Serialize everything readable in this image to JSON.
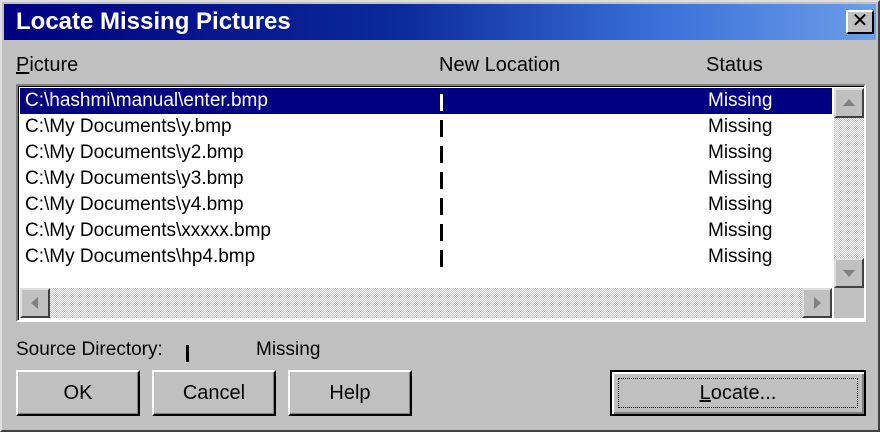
{
  "window": {
    "title": "Locate Missing Pictures",
    "close_label": "✕"
  },
  "columns": {
    "picture": "Picture",
    "new_location": "New Location",
    "status": "Status"
  },
  "rows": [
    {
      "picture": "C:\\hashmi\\manual\\enter.bmp",
      "status": "Missing",
      "selected": true
    },
    {
      "picture": "C:\\My Documents\\y.bmp",
      "status": "Missing",
      "selected": false
    },
    {
      "picture": "C:\\My Documents\\y2.bmp",
      "status": "Missing",
      "selected": false
    },
    {
      "picture": "C:\\My Documents\\y3.bmp",
      "status": "Missing",
      "selected": false
    },
    {
      "picture": "C:\\My Documents\\y4.bmp",
      "status": "Missing",
      "selected": false
    },
    {
      "picture": "C:\\My Documents\\xxxxx.bmp",
      "status": "Missing",
      "selected": false
    },
    {
      "picture": "C:\\My Documents\\hp4.bmp",
      "status": "Missing",
      "selected": false
    }
  ],
  "source": {
    "label": "Source Directory:",
    "status": "Missing"
  },
  "buttons": {
    "ok": "OK",
    "cancel": "Cancel",
    "help": "Help",
    "locate": "Locate..."
  },
  "colors": {
    "titlebar_start": "#000080",
    "titlebar_end": "#6d9ee8",
    "selection": "#000080",
    "face": "#c0c0c0"
  }
}
